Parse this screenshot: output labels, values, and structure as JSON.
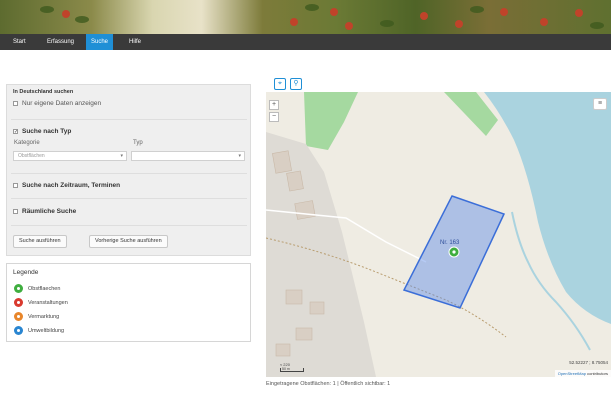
{
  "nav": {
    "items": [
      {
        "label": "Start",
        "active": false
      },
      {
        "label": "Erfassung",
        "active": false
      },
      {
        "label": "Suche",
        "active": true
      },
      {
        "label": "Hilfe",
        "active": false
      }
    ]
  },
  "search_panel": {
    "title": "In Deutschland suchen",
    "own_data_label": "Nur eigene Daten anzeigen",
    "by_type_label": "Suche nach Typ",
    "category_label": "Kategorie",
    "type_label": "Typ",
    "category_value": "Obstflächen",
    "type_value": "",
    "by_time_label": "Suche nach Zeitraum, Terminen",
    "spatial_label": "Räumliche Suche",
    "run_search_button": "Suche ausführen",
    "previous_search_button": "Vorherige Suche ausführen"
  },
  "legend": {
    "title": "Legende",
    "items": [
      {
        "label": "Obstflaechen",
        "color": "#3fae3f"
      },
      {
        "label": "Veranstaltungen",
        "color": "#d93a2f"
      },
      {
        "label": "Vermarktung",
        "color": "#e8862b"
      },
      {
        "label": "Umweltbildung",
        "color": "#2a86d1"
      }
    ]
  },
  "map": {
    "polygon_label": "Nr. 163",
    "scale_label": "≈ 220",
    "scale_unit": "50 m",
    "coords": "52.52227 ; 8.75054",
    "attribution_link": "OpenStreetMap",
    "attribution_rest": "contributors",
    "zoom_in": "+",
    "zoom_out": "−",
    "layers_icon": "layers-icon",
    "accent_color": "#1f8fd6",
    "polygon_color": "#3b6ed8"
  },
  "status": {
    "text": "Eingetragene Obstflächen: 1 | Öffentlich sichtbar: 1"
  }
}
